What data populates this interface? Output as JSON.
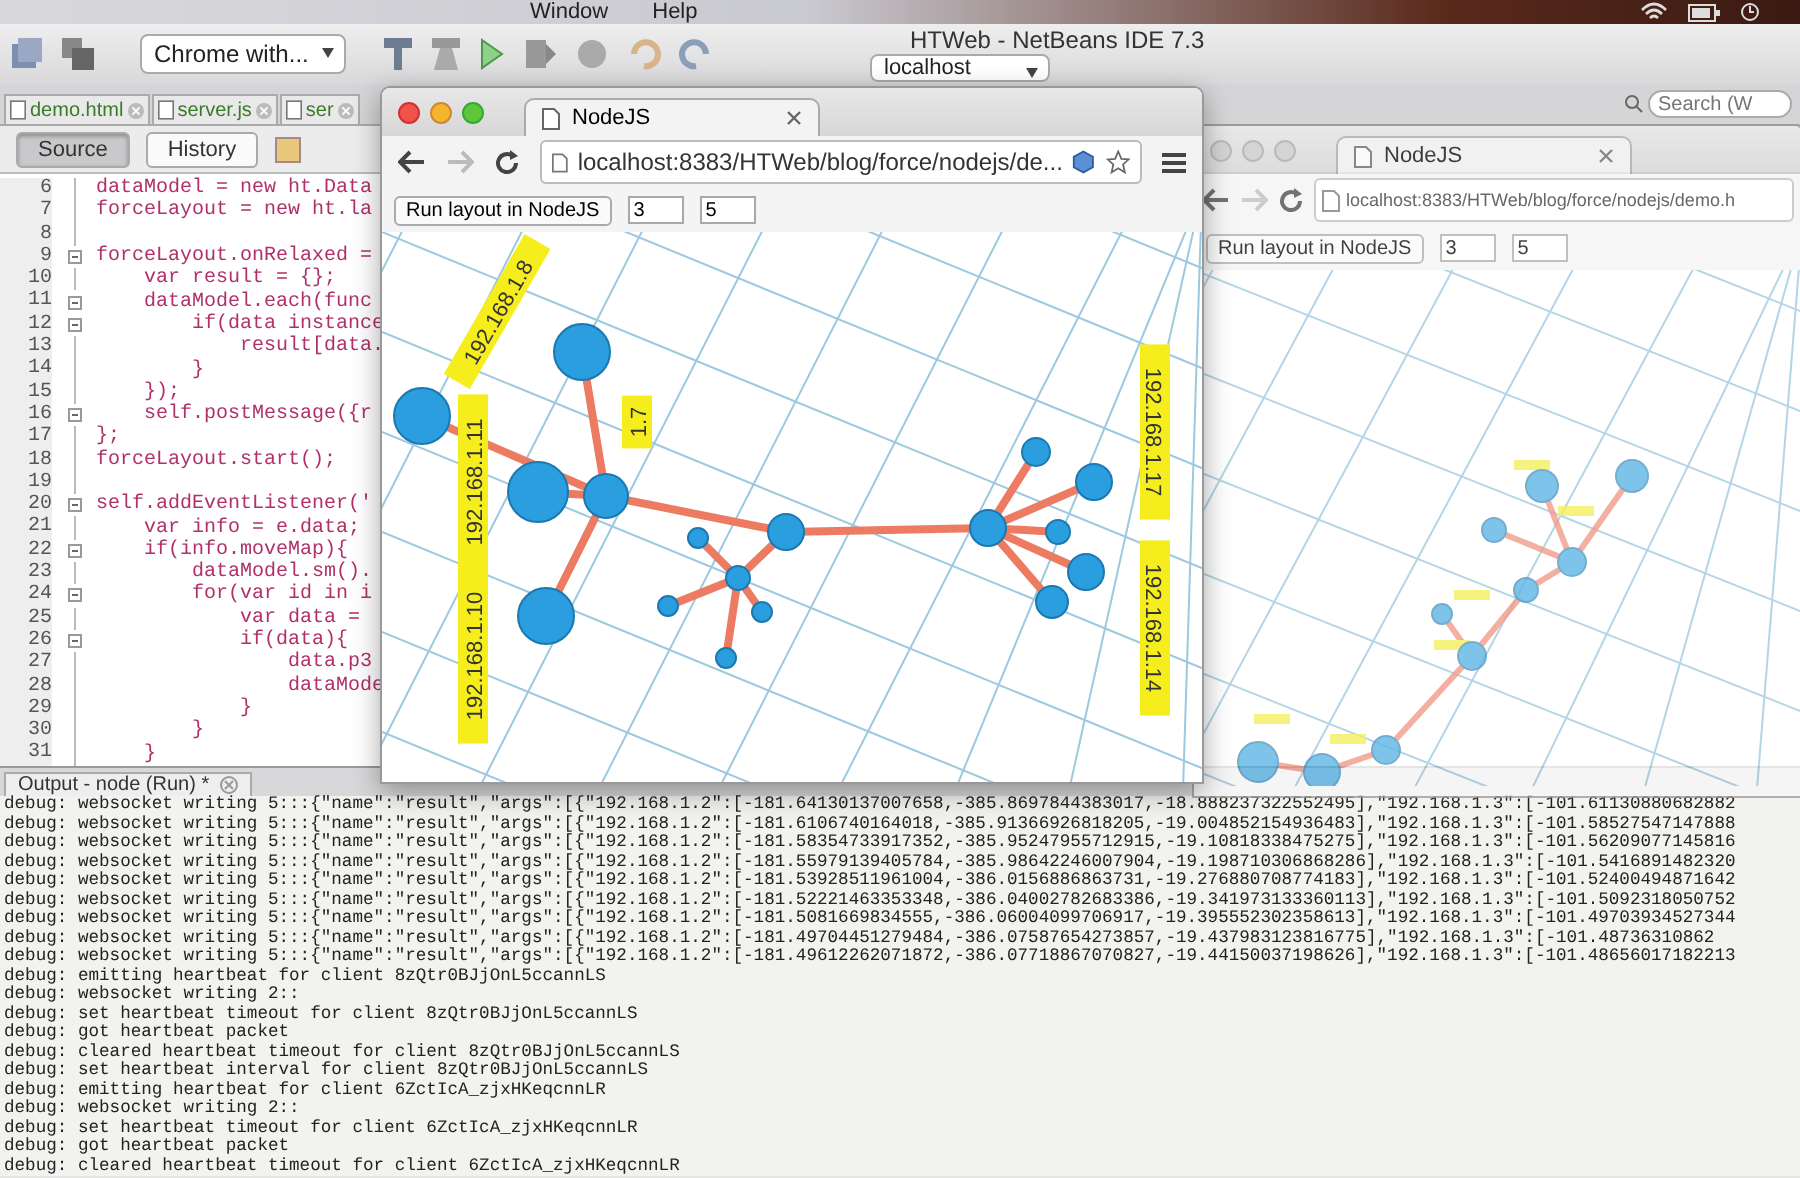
{
  "menu_bar": {
    "items": [
      "Window",
      "Help"
    ]
  },
  "ide": {
    "title": "HTWeb - NetBeans IDE 7.3",
    "browser_select": "Chrome with...",
    "server_select": "localhost",
    "search": {
      "placeholder": "Search (W"
    }
  },
  "editor_tabs": [
    {
      "label": "demo.html"
    },
    {
      "label": "server.js"
    },
    {
      "label": "ser"
    }
  ],
  "editor_views": [
    {
      "label": "Source",
      "selected": true
    },
    {
      "label": "History",
      "selected": false
    }
  ],
  "code_lines": [
    {
      "number": "6",
      "text": "dataModel = new ht.Data",
      "fold": false
    },
    {
      "number": "7",
      "text": "forceLayout = new ht.la",
      "fold": false
    },
    {
      "number": "8",
      "fold": false
    },
    {
      "number": "9",
      "text": "forceLayout.onRelaxed =",
      "fold": true
    },
    {
      "number": "10",
      "text": "    var result = {};",
      "fold": false
    },
    {
      "number": "11",
      "text": "    dataModel.each(func",
      "fold": true
    },
    {
      "number": "12",
      "text": "        if(data instance",
      "fold": true
    },
    {
      "number": "13",
      "text": "            result[data.",
      "fold": false
    },
    {
      "number": "14",
      "text": "        }",
      "fold": false
    },
    {
      "number": "15",
      "text": "    });",
      "fold": false
    },
    {
      "number": "16",
      "text": "    self.postMessage({r",
      "fold": true
    },
    {
      "number": "17",
      "text": "};",
      "fold": false
    },
    {
      "number": "18",
      "text": "forceLayout.start();",
      "fold": false
    },
    {
      "number": "19",
      "fold": false
    },
    {
      "number": "20",
      "text": "self.addEventListener('",
      "fold": true
    },
    {
      "number": "21",
      "text": "    var info = e.data;",
      "fold": false
    },
    {
      "number": "22",
      "text": "    if(info.moveMap){",
      "fold": true
    },
    {
      "number": "23",
      "text": "        dataModel.sm().",
      "fold": false
    },
    {
      "number": "24",
      "text": "        for(var id in i",
      "fold": true
    },
    {
      "number": "25",
      "text": "            var data =",
      "fold": false
    },
    {
      "number": "26",
      "text": "            if(data){",
      "fold": true
    },
    {
      "number": "27",
      "text": "                data.p3",
      "fold": false
    },
    {
      "number": "28",
      "text": "                dataMode",
      "fold": false
    },
    {
      "number": "29",
      "text": "            }",
      "fold": false
    },
    {
      "number": "30",
      "text": "        }",
      "fold": false
    },
    {
      "number": "31",
      "text": "    }",
      "fold": false
    }
  ],
  "output": {
    "title": "Output - node (Run) *",
    "lines": [
      "debug: websocket writing 5:::{\"name\":\"result\",\"args\":[{\"192.168.1.2\":[-181.64130137007658,-385.8697844383017,-18.888237322552495],\"192.168.1.3\":[-101.61130880682882",
      "debug: websocket writing 5:::{\"name\":\"result\",\"args\":[{\"192.168.1.2\":[-181.6106740164018,-385.91366926818205,-19.004852154936483],\"192.168.1.3\":[-101.58527547147888",
      "debug: websocket writing 5:::{\"name\":\"result\",\"args\":[{\"192.168.1.2\":[-181.58354733917352,-385.95247955712915,-19.10818338475275],\"192.168.1.3\":[-101.56209077145816",
      "debug: websocket writing 5:::{\"name\":\"result\",\"args\":[{\"192.168.1.2\":[-181.55979139405784,-385.98642246007904,-19.198710306868286],\"192.168.1.3\":[-101.5416891482320",
      "debug: websocket writing 5:::{\"name\":\"result\",\"args\":[{\"192.168.1.2\":[-181.53928511961004,-386.0156886863731,-19.276880708774183],\"192.168.1.3\":[-101.52400494871642",
      "debug: websocket writing 5:::{\"name\":\"result\",\"args\":[{\"192.168.1.2\":[-181.52221463353348,-386.04002782683386,-19.341973133360113],\"192.168.1.3\":[-101.5092318050752",
      "debug: websocket writing 5:::{\"name\":\"result\",\"args\":[{\"192.168.1.2\":[-181.5081669834555,-386.06004099706917,-19.395552302358613],\"192.168.1.3\":[-101.49703934527344",
      "debug: websocket writing 5:::{\"name\":\"result\",\"args\":[{\"192.168.1.2\":[-181.49704451279484,-386.07587654273857,-19.437983123816775],\"192.168.1.3\":[-101.48736310862",
      "debug: websocket writing 5:::{\"name\":\"result\",\"args\":[{\"192.168.1.2\":[-181.49612262071872,-386.07718867070827,-19.44150037198626],\"192.168.1.3\":[-101.48656017182213",
      "debug: emitting heartbeat for client 8zQtr0BJjOnL5ccannLS",
      "debug: websocket writing 2::",
      "debug: set heartbeat timeout for client 8zQtr0BJjOnL5ccannLS",
      "debug: got heartbeat packet",
      "debug: cleared heartbeat timeout for client 8zQtr0BJjOnL5ccannLS",
      "debug: set heartbeat interval for client 8zQtr0BJjOnL5ccannLS",
      "debug: emitting heartbeat for client 6ZctIcA_zjxHKeqcnnLR",
      "debug: websocket writing 2::",
      "debug: set heartbeat timeout for client 6ZctIcA_zjxHKeqcnnLR",
      "debug: got heartbeat packet",
      "debug: cleared heartbeat timeout for client 6ZctIcA_zjxHKeqcnnLR"
    ]
  },
  "browser_windows": [
    {
      "tab": "NodeJS",
      "url": "localhost:8383/HTWeb/blog/force/nodejs/de...",
      "active": true,
      "button": "Run layout in NodeJS",
      "inputs": [
        "3",
        "5"
      ],
      "graph_labels": [
        "192.168.1.8",
        "192.168.1.11",
        "192.168.1.10",
        "1.7",
        "192.168.1.17",
        "192.168.1.14"
      ]
    },
    {
      "tab": "NodeJS",
      "url": "localhost:8383/HTWeb/blog/force/nodejs/demo.h",
      "active": false,
      "button": "Run layout in NodeJS",
      "inputs": [
        "3",
        "5"
      ]
    }
  ]
}
